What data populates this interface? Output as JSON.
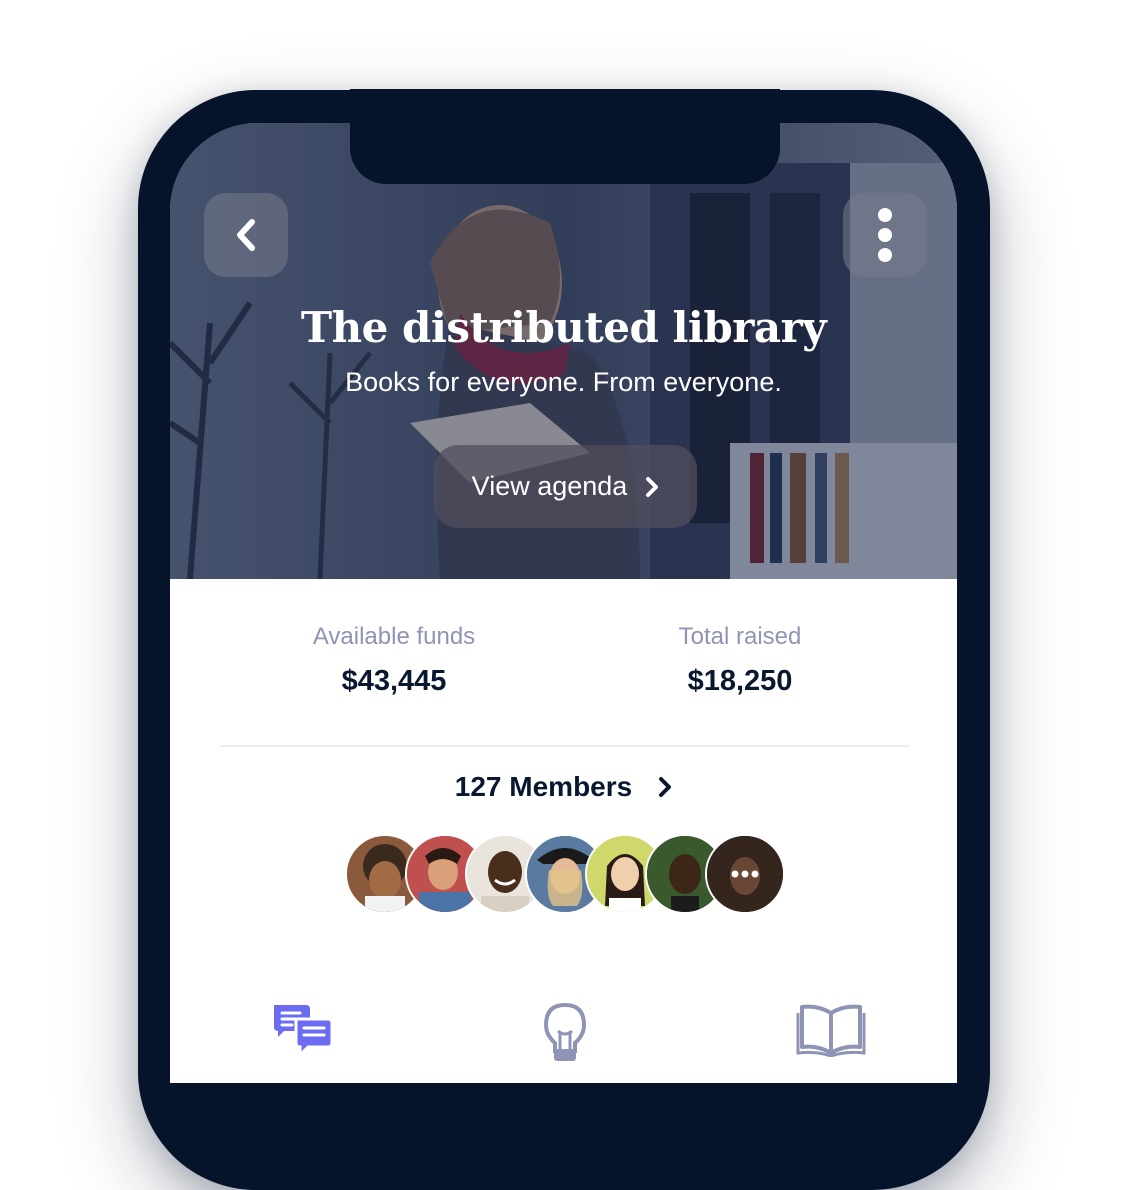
{
  "hero": {
    "title": "The distributed library",
    "subtitle": "Books for everyone. From everyone.",
    "agenda_button": "View agenda"
  },
  "stats": {
    "available_label": "Available funds",
    "available_value": "$43,445",
    "raised_label": "Total raised",
    "raised_value": "$18,250"
  },
  "members": {
    "label": "127 Members",
    "avatars": [
      {
        "name": "member-1",
        "bg": "#8b5a3c",
        "skin": "#a36b45"
      },
      {
        "name": "member-2",
        "bg": "#c0504d",
        "skin": "#d9a07a"
      },
      {
        "name": "member-3",
        "bg": "#e9e4dc",
        "skin": "#4a2e1c"
      },
      {
        "name": "member-4",
        "bg": "#5a7aa0",
        "skin": "#e6b896"
      },
      {
        "name": "member-5",
        "bg": "#cfd86a",
        "skin": "#f0cfae"
      },
      {
        "name": "member-6",
        "bg": "#3a5a2e",
        "skin": "#3b2618"
      },
      {
        "name": "member-7",
        "bg": "#3b2a20",
        "skin": "#8d5f44"
      }
    ],
    "more_count": "+"
  },
  "tabbar": {
    "items": [
      {
        "icon": "chat-icon",
        "active": true
      },
      {
        "icon": "lightbulb-icon",
        "active": false
      },
      {
        "icon": "book-icon",
        "active": false
      }
    ]
  },
  "colors": {
    "accent": "#6c6cf2",
    "inactive": "#8f94b4",
    "dark": "#0a1730",
    "frame": "#05132b"
  }
}
